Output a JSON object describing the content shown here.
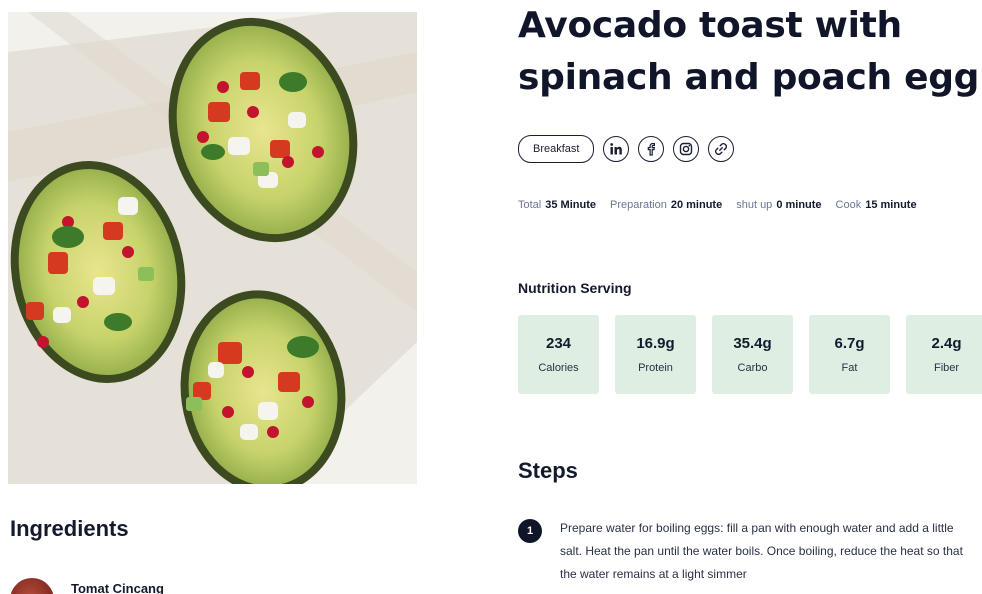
{
  "recipe": {
    "title": "Avocado toast with spinach and poach egg"
  },
  "tags": {
    "category": "Breakfast",
    "share_icons": [
      "linkedin-icon",
      "facebook-icon",
      "instagram-icon",
      "link-icon"
    ]
  },
  "times": [
    {
      "label": "Total",
      "value": "35 Minute"
    },
    {
      "label": "Preparation",
      "value": "20 minute"
    },
    {
      "label": "shut  up",
      "value": "0 minute"
    },
    {
      "label": "Cook",
      "value": "15 minute"
    }
  ],
  "nutrition": {
    "title": "Nutrition Serving",
    "items": [
      {
        "value": "234",
        "label": "Calories"
      },
      {
        "value": "16.9g",
        "label": "Protein"
      },
      {
        "value": "35.4g",
        "label": "Carbo"
      },
      {
        "value": "6.7g",
        "label": "Fat"
      },
      {
        "value": "2.4g",
        "label": "Fiber"
      }
    ],
    "card_color": "#deeee3"
  },
  "steps": {
    "title": "Steps",
    "items": [
      {
        "number": "1",
        "text": "Prepare water for boiling eggs: fill a pan with enough water and add a little salt. Heat the pan until the water boils. Once boiling, reduce the heat so that the water remains at a light simmer"
      }
    ]
  },
  "ingredients": {
    "title": "Ingredients",
    "items": [
      {
        "name": "Tomat Cincang"
      }
    ]
  }
}
